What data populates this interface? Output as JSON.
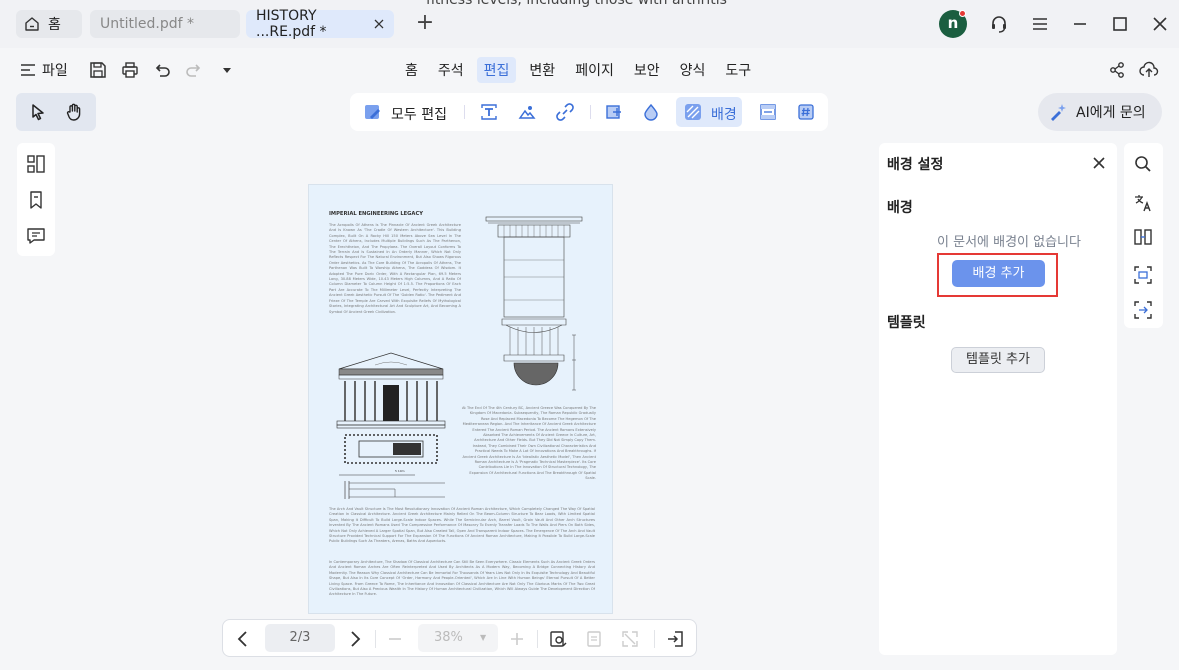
{
  "titlebar": {
    "home_label": "홈",
    "tabs": [
      {
        "label": "Untitled.pdf *",
        "active": false
      },
      {
        "label": "HISTORY ...RE.pdf *",
        "active": true
      }
    ],
    "new_tab": "+",
    "avatar_letter": "n",
    "overflow_text": "fitness levels, including those with arthritis"
  },
  "menubar": {
    "file_label": "파일",
    "menus": [
      "홈",
      "주석",
      "편집",
      "변환",
      "페이지",
      "보안",
      "양식",
      "도구"
    ],
    "active_menu": "편집"
  },
  "edit_toolbar": {
    "edit_all_label": "모두 편집",
    "background_label": "배경"
  },
  "ai": {
    "label": "AI에게 문의"
  },
  "document": {
    "title": "IMPERIAL ENGINEERING LEGACY",
    "para1": "The Acropolis Of Athens Is The Pinnacle Of Ancient Greek Architecture And Is Known As 'The Cradle Of Western Architecture'. This Building Complex, Built On A Rocky Hill 150 Meters Above Sea Level In The Center Of Athens, Includes Multiple Buildings Such As The Parthenon, The Erechtheion, And The Propylaea. The Overall Layout Conforms To The Terrain And Is Sustained In An Orderly Manner, Which Not Only Reflects Respect For The Natural Environment, But Also Shows Rigorous Order Aesthetics. As The Core Building Of The Acropolis Of Athens, The Parthenon Was Built To Worship Athena, The Goddess Of Wisdom. It Adopted The Pure Doric Order, With A Rectangular Plan, 69.5 Meters Long, 30.88 Meters Wide, 10.43 Meters High Columns, And A Ratio Of Column Diameter To Column Height Of 1:5.5. The Proportions Of Each Part Are Accurate To The Millimeter Level, Perfectly Interpreting The Ancient Greek Aesthetic Pursuit Of The 'Golden Ratio'. The Pediment And Frieze Of The Temple Are Carved With Exquisite Reliefs Of Mythological Stories, Integrating Architectural Art And Sculpture Art, And Becoming A Symbol Of Ancient Greek Civilization.",
    "para2": "At The End Of The 4th Century BC, Ancient Greece Was Conquered By The Kingdom Of Macedonia. Subsequently, The Roman Republic Gradually Rose And Replaced Macedonia To Become The Hegemon Of The Mediterranean Region. And The Inheritance Of Ancient Greek Architecture Entered The Ancient Roman Period. The Ancient Romans Extensively Absorbed The Achievements Of Ancient Greece In Culture, Art, Architecture And Other Fields. But They Did Not Simply Copy Them. Instead, They Combined Their Own Civilizational Characteristics And Practical Needs To Make A Lot Of Innovations And Breakthroughs. If Ancient Greek Architecture Is An 'Idealistic Aesthetic Model', Then Ancient Roman Architecture Is A 'Pragmatic Technical Masterpiece'. Its Core Contributions Lie In The Innovation Of Structural Technology, The Expansion Of Architectural Functions And The Breakthrough Of Spatial Scale.",
    "para3": "The Arch And Vault Structure Is The Most Revolutionary Innovation Of Ancient Roman Architecture, Which Completely Changed The Way Of Spatial Creation In Classical Architecture. Ancient Greek Architecture Mainly Relied On The Beam-Column Structure To Bear Loads, With Limited Spatial Span, Making It Difficult To Build Large-Scale Indoor Spaces. While The Semicircular Arch, Barrel Vault, Groin Vault And Other Arch Structures Invented By The Ancient Romans Used The Compressive Performance Of Masonry To Evenly Transfer Loads To The Walls And Piers On Both Sides, Which Not Only Achieved A Larger Spatial Span, But Also Created Tall, Open And Transparent Indoor Spaces. The Emergence Of The Arch And Vault Structure Provided Technical Support For The Expansion Of The Functions Of Ancient Roman Architecture, Making It Possible To Build Large-Scale Public Buildings Such As Theaters, Arenas, Baths And Aqueducts.",
    "para4": "In Contemporary Architecture, The Shadow Of Classical Architecture Can Still Be Seen Everywhere. Classic Elements Such As Ancient Greek Orders And Ancient Roman Arches Are Often Reinterpreted And Used By Architects As A Modern Way, Becoming A Bridge Connecting History And Modernity. The Reason Why Classical Architecture Can Be Immortal For Thousands Of Years Lies Not Only In Its Exquisite Technology And Beautiful Shape, But Also In Its Core Concept Of 'Order, Harmony And People-Oriented', Which Are In Line With Human Beings' Eternal Pursuit Of A Better Living Space. From Greece To Rome, The Inheritance And Innovation Of Classical Architecture Are Not Only The Glorious Marks Of The Two Great Civilizations, But Also A Precious Wealth In The History Of Human Architectural Civilization, Which Will Always Guide The Development Direction Of Architecture In The Future."
  },
  "bottom_bar": {
    "page": "2/3",
    "zoom": "38%"
  },
  "panel": {
    "title": "배경 설정",
    "bg_section": "배경",
    "empty_message": "이 문서에 배경이 없습니다",
    "add_bg_button": "배경 추가",
    "template_section": "템플릿",
    "add_template_button": "템플릿 추가"
  },
  "colors": {
    "accent": "#3b6fd8",
    "primary_button": "#6b93ec",
    "highlight_border": "#e53935",
    "avatar": "#1b5e40"
  }
}
